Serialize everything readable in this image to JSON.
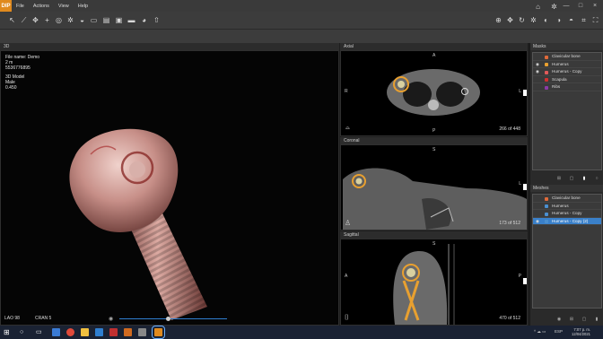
{
  "app": {
    "logo_text": "DIP",
    "menu": [
      "File",
      "Actions",
      "View",
      "Help"
    ],
    "window_controls": [
      "—",
      "□",
      "×"
    ],
    "top_right_icons": [
      "home-icon",
      "gear-icon"
    ]
  },
  "toolbar": {
    "left_icons": [
      "pointer-icon",
      "measure-icon",
      "move-icon",
      "crosshair-icon",
      "circle-icon",
      "gear-icon",
      "car-icon",
      "square-icon",
      "film-icon",
      "image-icon",
      "save-icon",
      "palette-icon",
      "upload-icon"
    ],
    "right_icons": [
      "zoom-icon",
      "pan-icon",
      "rotate-icon",
      "gear-icon",
      "contrast-icon",
      "window-icon",
      "window-icon",
      "crop-icon",
      "fullscreen-icon"
    ]
  },
  "view3d": {
    "title": "3D",
    "info": [
      "File name: Demo",
      "2 m",
      "5536776895",
      "3D Model",
      "Male",
      "0.450"
    ],
    "bottom_left": "LAO  98",
    "bottom_mid": "CRAN  5",
    "slider_value": 0.45
  },
  "axial": {
    "title": "Axial",
    "top": "A",
    "bottom": "P",
    "left": "R",
    "right": "L",
    "counter": "266 of 448"
  },
  "coronal": {
    "title": "Coronal",
    "top": "S",
    "right": "L",
    "counter": "173 of 512"
  },
  "sagittal": {
    "title": "Sagittal",
    "top": "S",
    "left": "A",
    "right": "P",
    "counter": "470 of 512"
  },
  "masks": {
    "title": "Masks",
    "items": [
      {
        "label": "Clavicular bone",
        "color": "#e06a3a",
        "visible": false
      },
      {
        "label": "Humerus",
        "color": "#e8a030",
        "visible": true
      },
      {
        "label": "Humerus - Copy",
        "color": "#e05a5a",
        "visible": true
      },
      {
        "label": "Scapula",
        "color": "#d03030",
        "visible": false
      },
      {
        "label": "Ribs",
        "color": "#8b3aa8",
        "visible": false
      }
    ]
  },
  "meshes": {
    "title": "Meshes",
    "items": [
      {
        "label": "Clavicular bone",
        "color": "#e06a3a",
        "selected": false
      },
      {
        "label": "Humerus",
        "color": "#4a8fd0",
        "selected": false
      },
      {
        "label": "Humerus - Copy",
        "color": "#4a8fd0",
        "selected": false
      },
      {
        "label": "Humerus - Copy (2)",
        "color": "#4a8fd0",
        "selected": true
      }
    ]
  },
  "taskbar": {
    "time": "7:07 p. m.",
    "date": "12/04/2021",
    "lang": "ESP"
  }
}
